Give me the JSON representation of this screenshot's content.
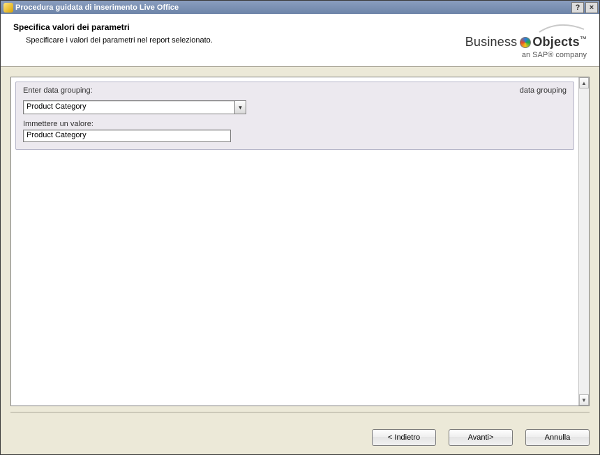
{
  "title": "Procedura guidata di inserimento Live Office",
  "header": {
    "heading": "Specifica valori dei parametri",
    "subheading": "Specificare i valori dei parametri nel report selezionato."
  },
  "logo": {
    "brand_prefix": "Business",
    "brand_bold": "Objects",
    "trademark": "™",
    "tagline": "an SAP® company"
  },
  "panel": {
    "group_label": "Enter data grouping:",
    "group_title_right": "data grouping",
    "combo": {
      "selected": "Product Category"
    },
    "value_label": "Immettere un valore:",
    "value_text": "Product Category"
  },
  "buttons": {
    "back": "< Indietro",
    "next": "Avanti>",
    "cancel": "Annulla"
  },
  "titlebar_icons": {
    "help": "?",
    "close": "×"
  },
  "scroll_icons": {
    "up": "▲",
    "down": "▼",
    "combo": "▼"
  }
}
